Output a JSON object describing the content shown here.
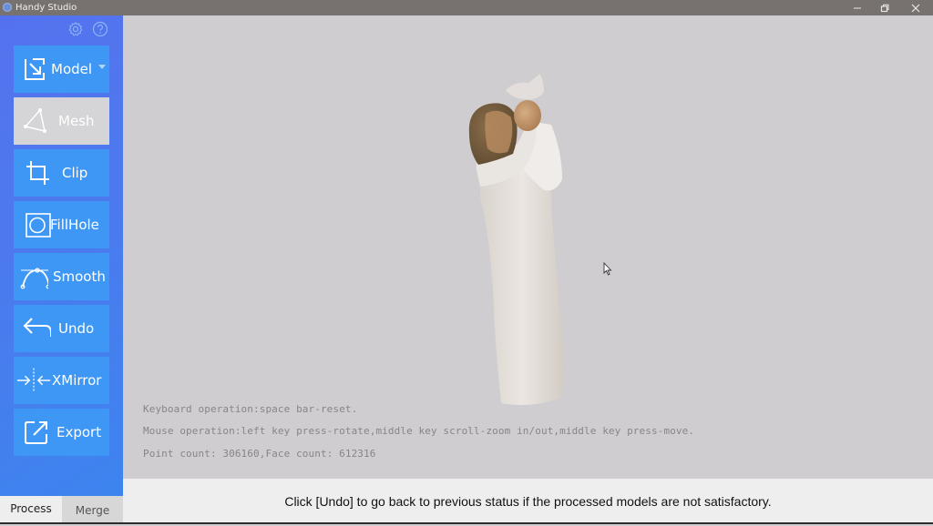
{
  "window": {
    "title": "Handy Studio",
    "controls": [
      "minimize-icon",
      "restore-icon",
      "close-icon"
    ]
  },
  "sidebar": {
    "top_icons": [
      "gear-icon",
      "help-icon"
    ],
    "tools": [
      {
        "label": "Model",
        "icon": "import-icon",
        "has_dropdown": true,
        "active": false
      },
      {
        "label": "Mesh",
        "icon": "mesh-triangle-icon",
        "active": true
      },
      {
        "label": "Clip",
        "icon": "crop-icon",
        "active": false
      },
      {
        "label": "FillHole",
        "icon": "fill-hole-icon",
        "active": false
      },
      {
        "label": "Smooth",
        "icon": "bezier-curve-icon",
        "active": false
      },
      {
        "label": "Undo",
        "icon": "undo-arrow-icon",
        "active": false
      },
      {
        "label": "XMirror",
        "icon": "mirror-icon",
        "active": false
      },
      {
        "label": "Export",
        "icon": "export-icon",
        "active": false
      }
    ],
    "tabs": [
      {
        "label": "Process",
        "active": true
      },
      {
        "label": "Merge",
        "active": false
      }
    ]
  },
  "viewport": {
    "model_description": "3D scanned figurine of a girl holding a dove",
    "info_lines": [
      "Keyboard operation:space bar-reset.",
      "Mouse operation:left key press-rotate,middle key scroll-zoom in/out,middle key press-move.",
      "Point count: 306160,Face count: 612316"
    ]
  },
  "status_bar": {
    "message": "Click [Undo] to go back to previous status if the processed models are not satisfactory."
  },
  "colors": {
    "titlebar": "#77726f",
    "sidebar": "#4d79ee",
    "tool_button": "#3e97f5",
    "tool_button_active": "#d5d4d6",
    "viewport": "#cfcdcf",
    "tab_accent": "#f0a23a"
  }
}
